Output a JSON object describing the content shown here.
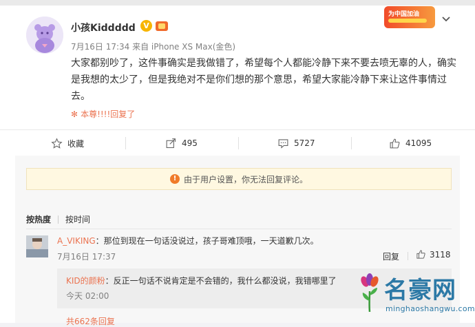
{
  "post": {
    "username": "小孩Kiddddd",
    "verified_mark": "V",
    "meta": "7月16日 17:34 来自 iPhone XS Max(金色)",
    "promo_text": "为中国加油",
    "text": "大家都别吵了，这件事确实是我做错了，希望每个人都能冷静下来不要去喷无辜的人，确实是我想的太少了，但是我绝对不是你们想的那个意思，希望大家能冷静下来让这件事情过去。",
    "reply_note": "本尊!!!!回复了",
    "icons": [
      "avatar-bear",
      "verified-v",
      "level-badge",
      "promo-badge",
      "chevron-down-icon",
      "flower-icon"
    ]
  },
  "actions": {
    "favorite": "收藏",
    "repost": "495",
    "comment": "5727",
    "like": "41095"
  },
  "notice": "由于用户设置，你无法回复评论。",
  "sort": {
    "hot": "按热度",
    "time": "按时间"
  },
  "comment": {
    "user": "A_VIKING",
    "text": "：那位到现在一句话没说过，孩子哥难顶哦，一天道歉几次。",
    "time": "7月16日 17:37",
    "reply_label": "回复",
    "likes": "3118"
  },
  "sub_reply": {
    "user": "KID的颜粉",
    "text": "：反正一句话不说肯定是不会错的，我什么都没说，我错哪里了",
    "time": "今天 02:00"
  },
  "more_replies": "共662条回复",
  "watermark": {
    "name": "名豪网",
    "url": "minghaoshangwu.com"
  },
  "colors": {
    "accent": "#eb7350",
    "watermark": "#2c79a6",
    "notice_bg": "#fff8e1"
  }
}
